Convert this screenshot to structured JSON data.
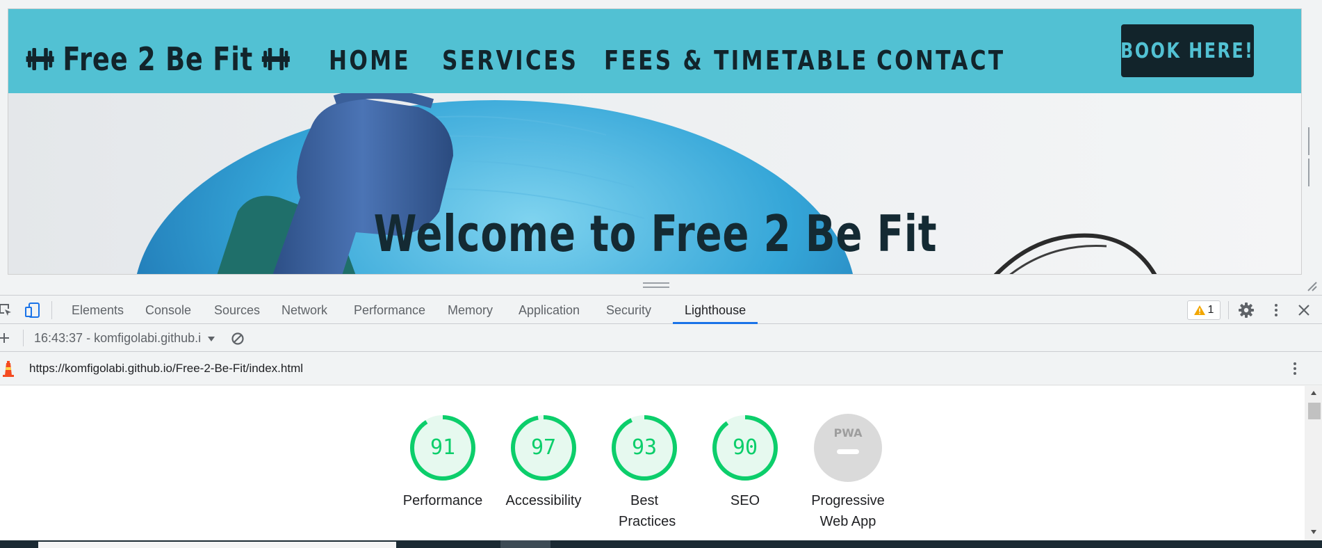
{
  "site": {
    "brand": "Free 2 Be Fit",
    "nav": [
      "HOME",
      "SERVICES",
      "FEES & TIMETABLE",
      "CONTACT"
    ],
    "cta": "BOOK HERE!",
    "hero_title": "Welcome to Free 2 Be Fit",
    "colors": {
      "nav_bg": "#52c1d3",
      "dark": "#12242b"
    }
  },
  "devtools": {
    "tabs": [
      "Elements",
      "Console",
      "Sources",
      "Network",
      "Performance",
      "Memory",
      "Application",
      "Security",
      "Lighthouse"
    ],
    "active_tab": "Lighthouse",
    "warnings_count": "1",
    "report_select": "16:43:37 - komfigolabi.github.i",
    "url": "https://komfigolabi.github.io/Free-2-Be-Fit/index.html",
    "icons": [
      "inspect-icon",
      "device-toolbar-icon",
      "warning-icon",
      "gear-icon",
      "kebab-menu-icon",
      "close-icon",
      "plus-icon",
      "dropdown-arrow-icon",
      "clear-icon",
      "lighthouse-icon"
    ]
  },
  "lighthouse": {
    "scores": [
      {
        "label": "Performance",
        "value": 91
      },
      {
        "label": "Accessibility",
        "value": 97
      },
      {
        "label": "Best Practices",
        "value": 93
      },
      {
        "label": "SEO",
        "value": 90
      }
    ],
    "pwa": {
      "label": "Progressive Web App",
      "badge": "PWA"
    },
    "colors": {
      "pass": "#0cce6b",
      "pass_bg": "#e6f9ef",
      "pwa_gray": "#dadada"
    }
  }
}
